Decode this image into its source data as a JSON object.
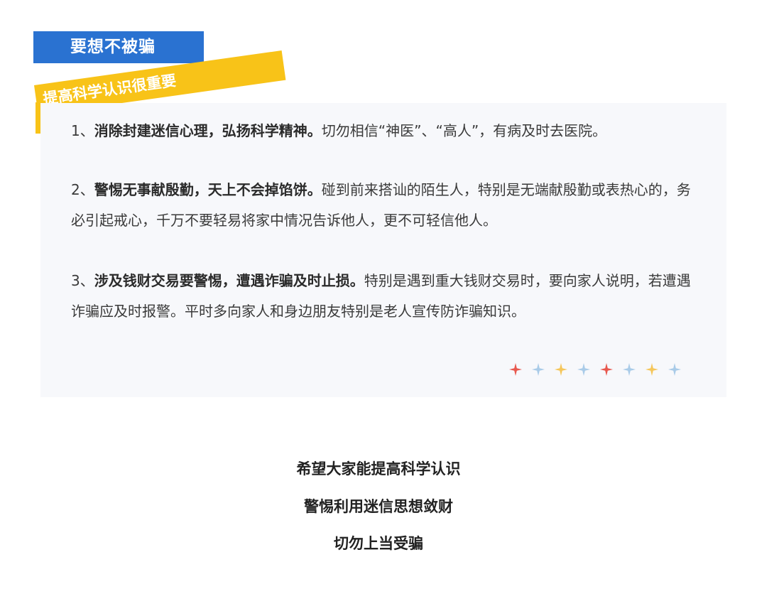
{
  "header": {
    "tab_title": "要想不被骗",
    "ribbon_text": "提高科学认识很重要"
  },
  "items": [
    {
      "num": "1、",
      "bold": "消除封建迷信心理，弘扬科学精神。",
      "text": "切勿相信“神医”、“高人”，有病及时去医院。"
    },
    {
      "num": "2、",
      "bold": "警惕无事献殷勤，天上不会掉馅饼。",
      "text": "碰到前来搭讪的陌生人，特别是无端献殷勤或表热心的，务必引起戒心，千万不要轻易将家中情况告诉他人，更不可轻信他人。"
    },
    {
      "num": "3、",
      "bold": "涉及钱财交易要警惕，遭遇诈骗及时止损。",
      "text": "特别是遇到重大钱财交易时，要向家人说明，若遭遇诈骗应及时报警。平时多向家人和身边朋友特别是老人宣传防诈骗知识。"
    }
  ],
  "decoration": {
    "star_icon": "four-point-sparkle-icon",
    "star_colors": [
      "#e8584e",
      "#a9cbe8",
      "#f5c65a",
      "#a9cbe8",
      "#e8584e",
      "#a9cbe8",
      "#f5c65a",
      "#a9cbe8"
    ]
  },
  "closing": {
    "line1": "希望大家能提高科学认识",
    "line2": "警惕利用迷信思想敛财",
    "line3": "切勿上当受骗"
  },
  "colors": {
    "tab_blue": "#2a72d1",
    "ribbon_yellow": "#f8c318",
    "card_bg": "#f7f8fb"
  }
}
